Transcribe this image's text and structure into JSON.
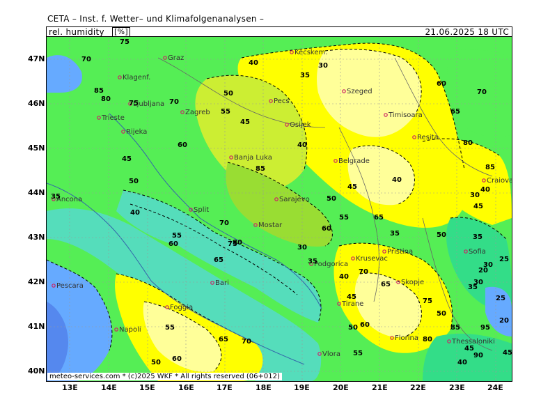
{
  "header": {
    "title": "CETA – Inst. f. Wetter– und Klimafolgenanalysen –",
    "parameter": "rel. humidity",
    "unit": "[%]",
    "datetime": "21.06.2025 18 UTC"
  },
  "copyright": "meteo-services.com * (c)2025 WKF * All rights reserved (06+012)",
  "axes": {
    "lat_labels": [
      "47N",
      "46N",
      "45N",
      "44N",
      "43N",
      "42N",
      "41N",
      "40N"
    ],
    "lon_labels": [
      "13E",
      "14E",
      "15E",
      "16E",
      "17E",
      "18E",
      "19E",
      "20E",
      "21E",
      "22E",
      "23E",
      "24E"
    ]
  },
  "legend_colors": {
    "very_dry": "#ffff99",
    "dry": "#ffff00",
    "mid_dry": "#ccee33",
    "mid": "#99dd33",
    "moist": "#55ee55",
    "humid": "#33dd88",
    "sea": "#55ddbb",
    "very_humid": "#66aaff",
    "saturated": "#5588ee"
  },
  "cities": [
    {
      "name": "Graz"
    },
    {
      "name": "Klagenf."
    },
    {
      "name": "Ljubljana"
    },
    {
      "name": "Zagreb"
    },
    {
      "name": "Trieste"
    },
    {
      "name": "Rijeka"
    },
    {
      "name": "Pecs"
    },
    {
      "name": "Szeged"
    },
    {
      "name": "Timisoara"
    },
    {
      "name": "Osijek"
    },
    {
      "name": "Banja Luka"
    },
    {
      "name": "Belgrade"
    },
    {
      "name": "Resita"
    },
    {
      "name": "Craiova"
    },
    {
      "name": "Sarajevo"
    },
    {
      "name": "Split"
    },
    {
      "name": "Mostar"
    },
    {
      "name": "Ancona"
    },
    {
      "name": "Pescara"
    },
    {
      "name": "Podgorica"
    },
    {
      "name": "Krusevac"
    },
    {
      "name": "Skopje"
    },
    {
      "name": "Sofia"
    },
    {
      "name": "Tirane"
    },
    {
      "name": "Foggia"
    },
    {
      "name": "Bari"
    },
    {
      "name": "Thessaloniki"
    },
    {
      "name": "Florina"
    },
    {
      "name": "Vlora"
    },
    {
      "name": "Napoli"
    },
    {
      "name": "Kecskem."
    },
    {
      "name": "Pristina"
    }
  ],
  "contour_labels": [
    "75",
    "70",
    "85",
    "80",
    "75",
    "70",
    "60",
    "55",
    "50",
    "40",
    "45",
    "35",
    "30",
    "40",
    "50",
    "60",
    "65",
    "55",
    "45",
    "40",
    "35",
    "30",
    "50",
    "60",
    "70",
    "65",
    "80",
    "85",
    "45",
    "40",
    "35",
    "30",
    "20",
    "25",
    "35",
    "40",
    "45",
    "50",
    "55",
    "60",
    "65",
    "70",
    "75",
    "80",
    "85",
    "30",
    "35",
    "40",
    "45",
    "50",
    "55",
    "60",
    "65",
    "70",
    "75",
    "80",
    "85",
    "90",
    "95",
    "50",
    "40",
    "45",
    "35",
    "30",
    "25",
    "20",
    "45",
    "50",
    "55",
    "60",
    "65",
    "70"
  ]
}
